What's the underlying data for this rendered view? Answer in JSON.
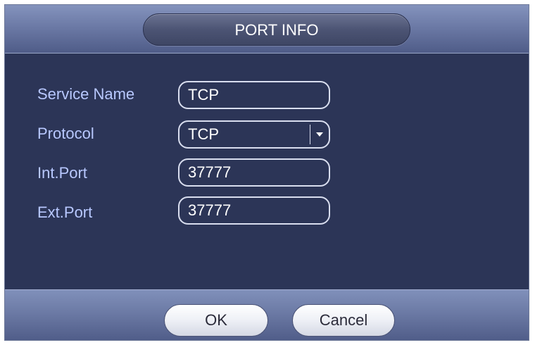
{
  "dialog": {
    "title": "PORT INFO"
  },
  "form": {
    "service_name": {
      "label": "Service Name",
      "value": "TCP"
    },
    "protocol": {
      "label": "Protocol",
      "value": "TCP"
    },
    "int_port": {
      "label": "Int.Port",
      "value": "37777"
    },
    "ext_port": {
      "label": "Ext.Port",
      "value": "37777"
    }
  },
  "buttons": {
    "ok": "OK",
    "cancel": "Cancel"
  },
  "icons": {
    "protocol_dropdown": "chevron-down-icon"
  },
  "colors": {
    "background": "#2c3557",
    "label_text": "#b8c8ff",
    "header_footer": "#6c7aa6",
    "field_border": "#d9deef"
  }
}
